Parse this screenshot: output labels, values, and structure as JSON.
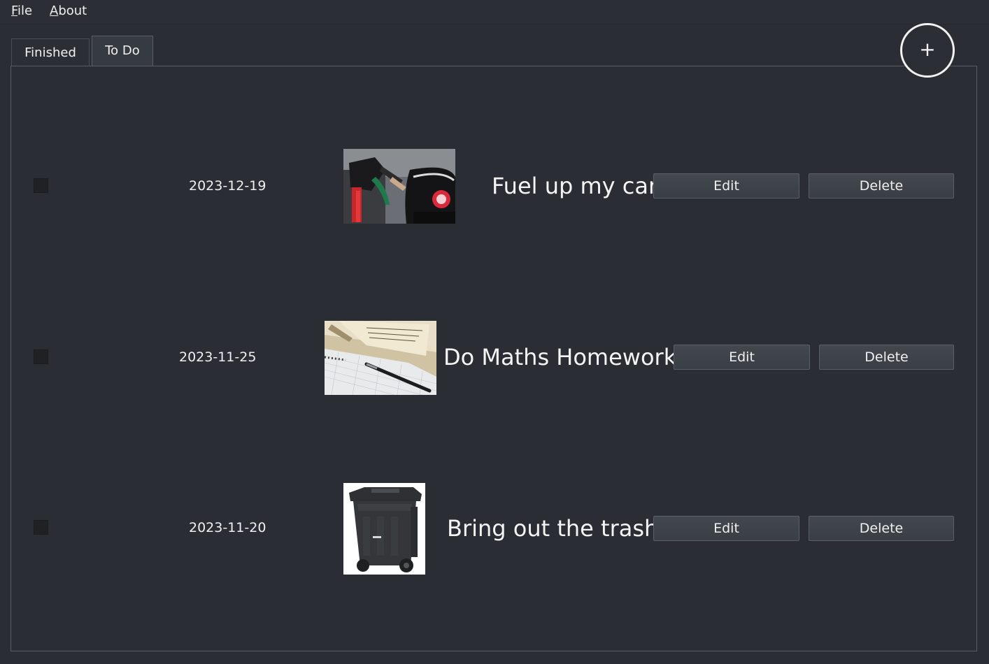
{
  "menu": {
    "file_first": "F",
    "file_rest": "ile",
    "about_first": "A",
    "about_rest": "bout"
  },
  "tabs": {
    "finished": "Finished",
    "todo": "To Do"
  },
  "add_button": "+",
  "tasks": [
    {
      "date": "2023-12-19",
      "title": "Fuel up my car",
      "image": "car-fuel-photo",
      "edit": "Edit",
      "delete": "Delete"
    },
    {
      "date": "2023-11-25",
      "title": "Do Maths Homework",
      "image": "homework-notebook-photo",
      "edit": "Edit",
      "delete": "Delete"
    },
    {
      "date": "2023-11-20",
      "title": "Bring out the trash",
      "image": "trash-bin-photo",
      "edit": "Edit",
      "delete": "Delete"
    }
  ]
}
